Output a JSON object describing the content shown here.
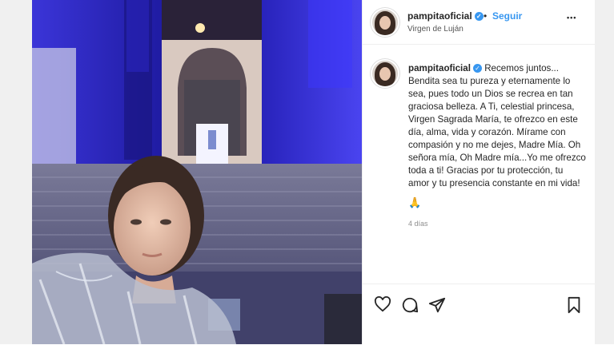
{
  "post": {
    "username": "pampitaoficial",
    "follow_label": "Seguir",
    "separator": "•",
    "location": "Virgen de Luján",
    "more_label": "•••",
    "caption_username": "pampitaoficial",
    "caption_text": "Recemos juntos... Bendita sea tu pureza y eternamente lo sea, pues todo un Dios se recrea en tan graciosa belleza. A Ti, celestial princesa, Virgen Sagrada María, te ofrezco en este día, alma, vida y corazón. Mírame con compasión y no me dejes, Madre Mía. Oh señora mía, Oh Madre mía...Yo me ofrezco toda a ti! Gracias por tu protección, tu amor y tu presencia constante en mi vida!",
    "caption_emoji": "🙏",
    "timestamp": "4 días"
  },
  "icons": {
    "verified": "verified-badge-icon",
    "like": "heart-icon",
    "comment": "comment-icon",
    "share": "send-icon",
    "save": "bookmark-icon"
  },
  "colors": {
    "accent": "#3897f0",
    "text": "#262626",
    "muted": "#8e8e8e",
    "photo_light": "#3a3aff"
  }
}
